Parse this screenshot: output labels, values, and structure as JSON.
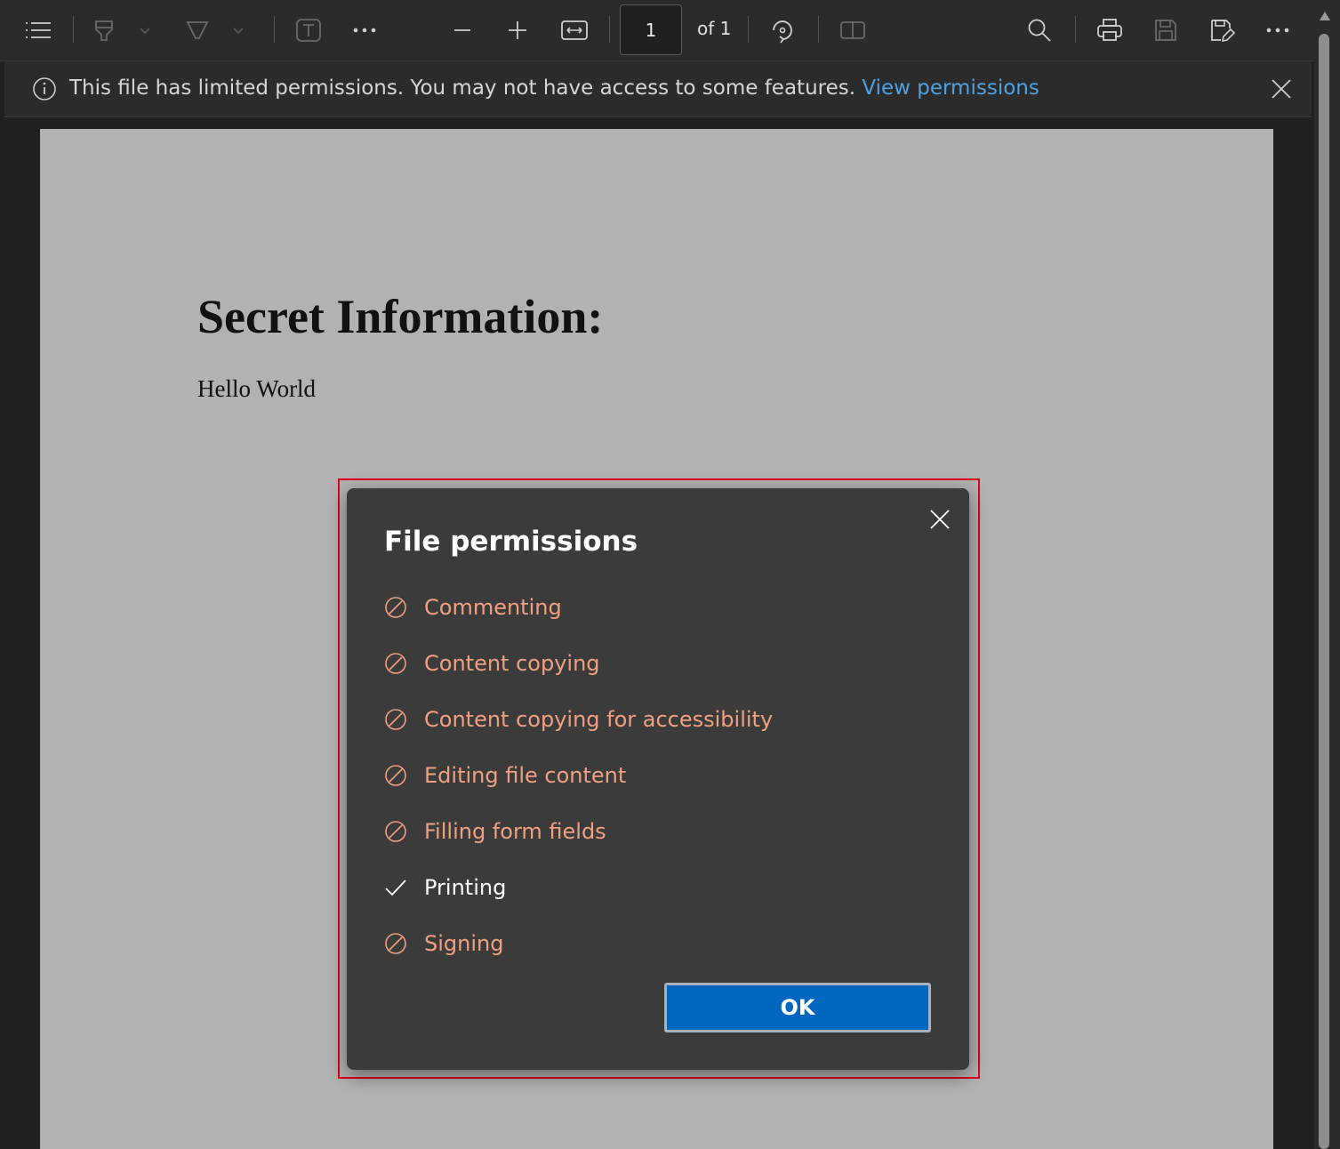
{
  "toolbar": {
    "page_number": "1",
    "page_of": "of 1"
  },
  "infobar": {
    "message": "This file has limited permissions. You may not have access to some features.",
    "link": "View permissions"
  },
  "document": {
    "title": "Secret Information:",
    "body": "Hello World"
  },
  "dialog": {
    "title": "File permissions",
    "permissions": [
      {
        "label": "Commenting",
        "allowed": false
      },
      {
        "label": "Content copying",
        "allowed": false
      },
      {
        "label": "Content copying for accessibility",
        "allowed": false
      },
      {
        "label": "Editing file content",
        "allowed": false
      },
      {
        "label": "Filling form fields",
        "allowed": false
      },
      {
        "label": "Printing",
        "allowed": true
      },
      {
        "label": "Signing",
        "allowed": false
      }
    ],
    "ok_label": "OK"
  },
  "colors": {
    "denied": "#f0a080",
    "allowed": "#ffffff",
    "link": "#4ea1e2",
    "primary_button": "#0067c0",
    "highlight_border": "#e0001b"
  },
  "icons": [
    "contents-icon",
    "highlight-icon",
    "draw-icon",
    "text-icon",
    "more-icon",
    "zoom-out-icon",
    "zoom-in-icon",
    "fit-width-icon",
    "rotate-icon",
    "page-view-icon",
    "search-icon",
    "print-icon",
    "save-icon",
    "save-as-icon",
    "info-icon",
    "close-icon",
    "blocked-icon",
    "check-icon"
  ]
}
